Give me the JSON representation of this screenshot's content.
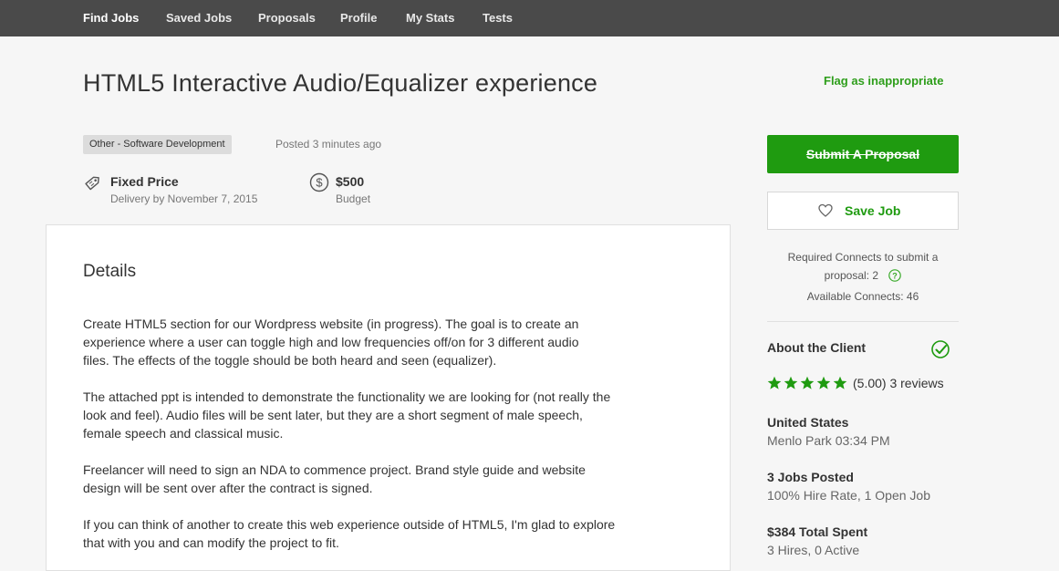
{
  "nav": {
    "items": [
      "Find Jobs",
      "Saved Jobs",
      "Proposals",
      "Profile",
      "My Stats",
      "Tests"
    ]
  },
  "job": {
    "title": "HTML5 Interactive Audio/Equalizer experience",
    "flag_label": "Flag as inappropriate",
    "category": "Other - Software Development",
    "posted": "Posted 3 minutes ago",
    "price_type": "Fixed Price",
    "delivery": "Delivery by November 7, 2015",
    "budget_value": "$500",
    "budget_label": "Budget"
  },
  "details": {
    "heading": "Details",
    "paragraphs": [
      "Create HTML5 section for our Wordpress website (in progress).  The goal is to create an\nexperience where a user can toggle high and low frequencies off/on for 3 different audio\nfiles.   The effects of the toggle should be both heard and seen (equalizer).",
      "The attached ppt is intended to demonstrate the functionality we are looking for (not really the\nlook and feel).  Audio files will be sent later, but they are a short segment of male speech,\nfemale speech and classical music.",
      "Freelancer will need to sign an NDA to commence project.  Brand style guide and website\ndesign will be sent over after the contract is signed.",
      "If you can think of another to create this web experience outside of HTML5, I'm glad to explore\nthat with you and can modify the project to fit."
    ]
  },
  "sidebar": {
    "submit_label": "Submit A Proposal",
    "save_label": "Save Job",
    "connects_required": "Required Connects to submit a proposal: 2",
    "connects_available": "Available Connects: 46",
    "about_label": "About the Client",
    "rating_value": 5,
    "rating_text": "(5.00) 3 reviews",
    "location_country": "United States",
    "location_city": "Menlo Park 03:34 PM",
    "jobs_posted": "3 Jobs Posted",
    "hire_rate": "100% Hire Rate, 1 Open Job",
    "total_spent": "$384 Total Spent",
    "hires": "3 Hires, 0 Active"
  },
  "colors": {
    "nav_bg": "#4a4a4a",
    "accent_green": "#1f9b10",
    "link_green": "#2e9e1b"
  },
  "icons": {
    "price_type": "price-tag-icon",
    "budget": "dollar-circle-icon",
    "save": "heart-icon",
    "help": "question-circle-icon",
    "verified": "verified-check-icon",
    "star": "star-icon"
  }
}
